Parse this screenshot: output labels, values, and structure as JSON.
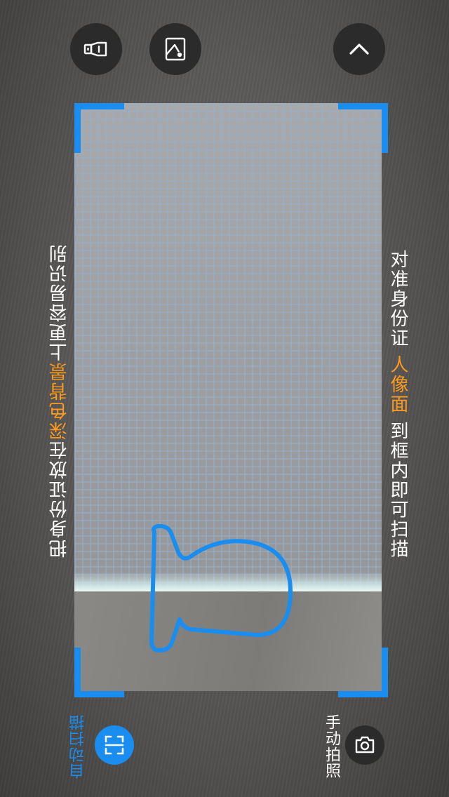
{
  "toolbar": {
    "flash_icon": "flashlight-icon",
    "album_icon": "image-album-icon",
    "collapse_icon": "chevron-up-icon"
  },
  "hints": {
    "right": {
      "prefix": "对准身份证 ",
      "highlight": "人像面",
      "suffix": " 到框内即可扫描"
    },
    "left": {
      "prefix": "把身份证放在",
      "highlight": "深色背景",
      "suffix": "上更容易识别"
    }
  },
  "modes": {
    "auto_label": "自动扫描",
    "manual_label": "手动拍照",
    "auto_icon": "scan-frame-icon",
    "manual_icon": "camera-icon"
  },
  "colors": {
    "accent_blue": "#1a8df0",
    "highlight_orange": "#ff9a1f"
  }
}
